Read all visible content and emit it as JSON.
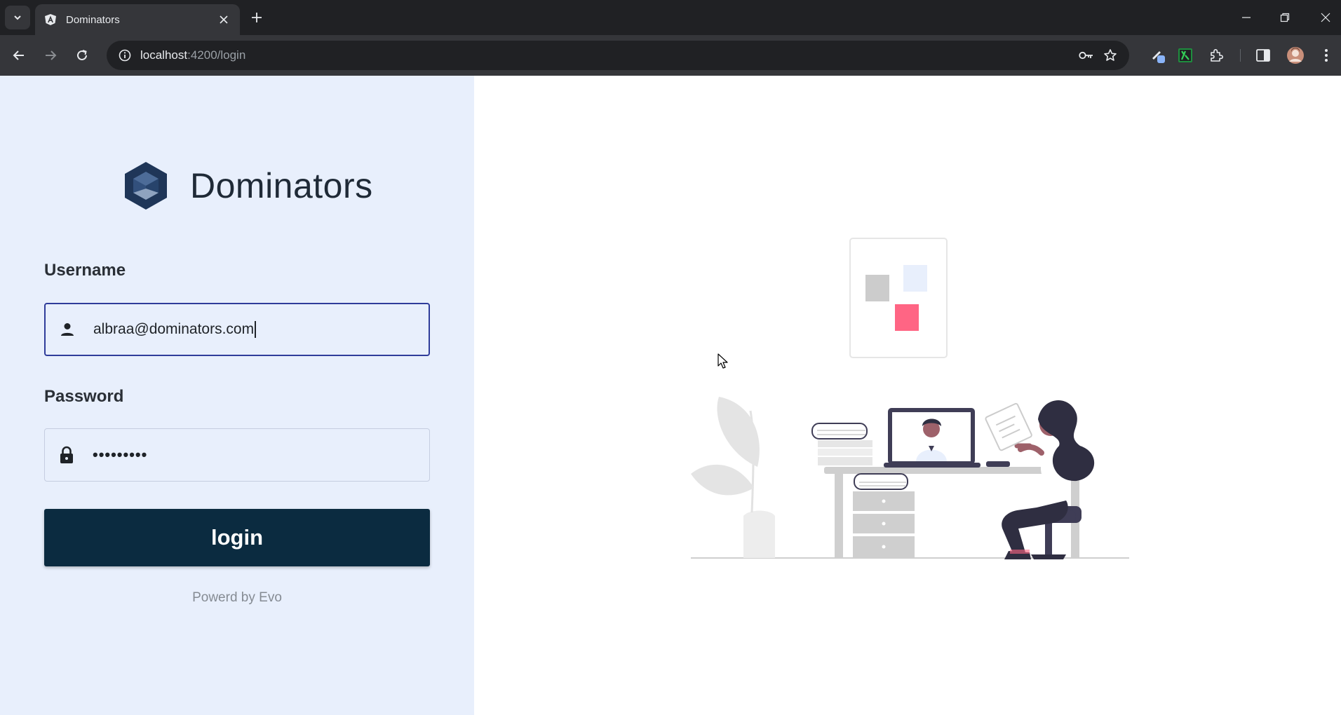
{
  "browser": {
    "tab": {
      "title": "Dominators"
    },
    "url": {
      "host": "localhost",
      "path": ":4200/login"
    }
  },
  "login": {
    "brand": "Dominators",
    "username_label": "Username",
    "username_value": "albraa@dominators.com",
    "password_label": "Password",
    "password_mask": "•••••••••",
    "login_label": "login",
    "footer": "Powerd by Evo"
  },
  "colors": {
    "panel_bg": "#e8effc",
    "button_bg": "#0b2b40",
    "focus_border": "#2f3c9a",
    "accent_pink": "#ff6584"
  },
  "icons": {
    "username_field": "person-icon",
    "password_field": "lock-icon"
  }
}
